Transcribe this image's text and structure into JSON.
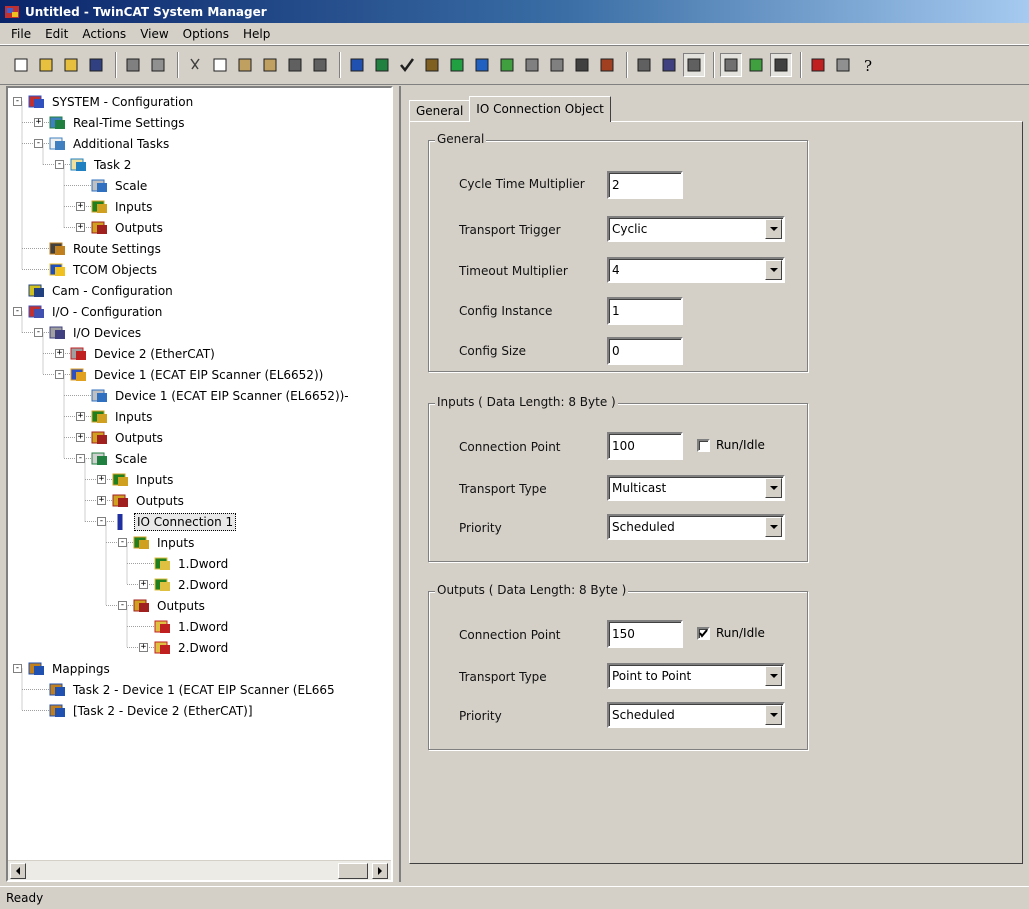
{
  "window": {
    "title": "Untitled - TwinCAT System Manager"
  },
  "menu": [
    "File",
    "Edit",
    "Actions",
    "View",
    "Options",
    "Help"
  ],
  "toolbar": {
    "buttons": [
      "new-icon",
      "open-icon",
      "open-folder-icon",
      "save-icon",
      "sep",
      "print-icon",
      "print-preview-icon",
      "sep",
      "cut-icon",
      "copy-icon",
      "paste-icon",
      "paste-with-links-icon",
      "find-icon",
      "find-next-icon",
      "sep",
      "generate-mappings-icon",
      "check-configuration-icon",
      "check-mark-icon",
      "activate-configuration-icon",
      "set-run-mode-icon",
      "restart-config-mode-icon",
      "choose-target-icon",
      "scan-devices-icon",
      "toggle-free-run-icon",
      "refresh-icon",
      "show-online-data-icon",
      "sep",
      "online-icon",
      "zoom-icon",
      "network-icon",
      "sep",
      "show-variables-icon",
      "trigger-icon",
      "force-icon",
      "sep",
      "book-icon",
      "info-icon",
      "help-icon"
    ],
    "pressed": [
      "network-icon",
      "show-variables-icon",
      "force-icon"
    ]
  },
  "tree": [
    {
      "label": "SYSTEM - Configuration",
      "depth": 0,
      "exp": "-",
      "icon": "system-config-icon"
    },
    {
      "label": "Real-Time Settings",
      "depth": 1,
      "exp": "+",
      "icon": "realtime-settings-icon"
    },
    {
      "label": "Additional Tasks",
      "depth": 1,
      "exp": "-",
      "icon": "additional-tasks-icon"
    },
    {
      "label": "Task 2",
      "depth": 2,
      "exp": "-",
      "icon": "task-icon"
    },
    {
      "label": "Scale",
      "depth": 3,
      "exp": "",
      "icon": "scale-icon"
    },
    {
      "label": "Inputs",
      "depth": 3,
      "exp": "+",
      "icon": "inputs-icon"
    },
    {
      "label": "Outputs",
      "depth": 3,
      "exp": "+",
      "icon": "outputs-icon"
    },
    {
      "label": "Route Settings",
      "depth": 1,
      "exp": "",
      "icon": "route-settings-icon"
    },
    {
      "label": "TCOM Objects",
      "depth": 1,
      "exp": "",
      "icon": "tcom-objects-icon"
    },
    {
      "label": "Cam - Configuration",
      "depth": 0,
      "exp": "",
      "icon": "cam-config-icon"
    },
    {
      "label": "I/O - Configuration",
      "depth": 0,
      "exp": "-",
      "icon": "io-config-icon"
    },
    {
      "label": "I/O Devices",
      "depth": 1,
      "exp": "-",
      "icon": "io-devices-icon"
    },
    {
      "label": "Device 2 (EtherCAT)",
      "depth": 2,
      "exp": "+",
      "icon": "ethercat-device-icon"
    },
    {
      "label": "Device 1 (ECAT EIP Scanner (EL6652))",
      "depth": 2,
      "exp": "-",
      "icon": "eip-scanner-icon"
    },
    {
      "label": "Device 1 (ECAT EIP Scanner (EL6652))-",
      "depth": 3,
      "exp": "",
      "icon": "scale-icon"
    },
    {
      "label": "Inputs",
      "depth": 3,
      "exp": "+",
      "icon": "inputs-icon"
    },
    {
      "label": "Outputs",
      "depth": 3,
      "exp": "+",
      "icon": "outputs-icon"
    },
    {
      "label": "Scale",
      "depth": 3,
      "exp": "-",
      "icon": "box-icon"
    },
    {
      "label": "Inputs",
      "depth": 4,
      "exp": "+",
      "icon": "inputs-icon"
    },
    {
      "label": "Outputs",
      "depth": 4,
      "exp": "+",
      "icon": "outputs-icon"
    },
    {
      "label": "IO Connection 1",
      "depth": 4,
      "exp": "-",
      "icon": "connection-icon",
      "selected": true
    },
    {
      "label": "Inputs",
      "depth": 5,
      "exp": "-",
      "icon": "inputs-icon"
    },
    {
      "label": "1.Dword",
      "depth": 6,
      "exp": "",
      "icon": "input-var-icon"
    },
    {
      "label": "2.Dword",
      "depth": 6,
      "exp": "+",
      "icon": "input-var-icon"
    },
    {
      "label": "Outputs",
      "depth": 5,
      "exp": "-",
      "icon": "outputs-icon"
    },
    {
      "label": "1.Dword",
      "depth": 6,
      "exp": "",
      "icon": "output-var-icon"
    },
    {
      "label": "2.Dword",
      "depth": 6,
      "exp": "+",
      "icon": "output-var-icon"
    },
    {
      "label": "Mappings",
      "depth": 0,
      "exp": "-",
      "icon": "mappings-icon"
    },
    {
      "label": "Task 2 - Device 1 (ECAT EIP Scanner (EL665",
      "depth": 1,
      "exp": "",
      "icon": "mapping-icon"
    },
    {
      "label": "[Task 2 - Device 2 (EtherCAT)]",
      "depth": 1,
      "exp": "",
      "icon": "mapping-icon"
    }
  ],
  "tabs": [
    {
      "label": "General",
      "active": false
    },
    {
      "label": "IO Connection Object",
      "active": true
    }
  ],
  "general_group": {
    "title": "General",
    "cycle_time_multiplier": {
      "label": "Cycle Time Multiplier",
      "value": "2"
    },
    "transport_trigger": {
      "label": "Transport Trigger",
      "value": "Cyclic"
    },
    "timeout_multiplier": {
      "label": "Timeout Multiplier",
      "value": "4"
    },
    "config_instance": {
      "label": "Config Instance",
      "value": "1"
    },
    "config_size": {
      "label": "Config Size",
      "value": "0"
    }
  },
  "inputs_group": {
    "title": "Inputs ( Data Length: 8 Byte )",
    "connection_point": {
      "label": "Connection Point",
      "value": "100"
    },
    "run_idle": {
      "label": "Run/Idle",
      "checked": false
    },
    "transport_type": {
      "label": "Transport Type",
      "value": "Multicast"
    },
    "priority": {
      "label": "Priority",
      "value": "Scheduled"
    }
  },
  "outputs_group": {
    "title": "Outputs ( Data Length: 8 Byte )",
    "connection_point": {
      "label": "Connection Point",
      "value": "150"
    },
    "run_idle": {
      "label": "Run/Idle",
      "checked": true
    },
    "transport_type": {
      "label": "Transport Type",
      "value": "Point to Point"
    },
    "priority": {
      "label": "Priority",
      "value": "Scheduled"
    }
  },
  "status": {
    "text": "Ready"
  }
}
